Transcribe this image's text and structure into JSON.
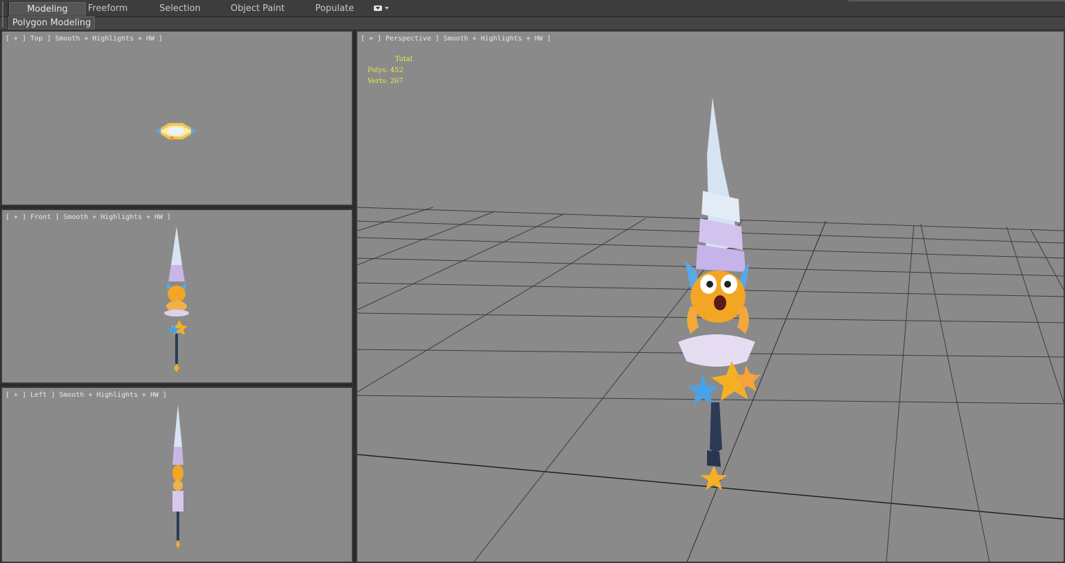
{
  "ribbon": {
    "tabs": [
      {
        "label": "Modeling",
        "active": true
      },
      {
        "label": "Freeform",
        "active": false
      },
      {
        "label": "Selection",
        "active": false
      },
      {
        "label": "Object Paint",
        "active": false
      },
      {
        "label": "Populate",
        "active": false
      }
    ],
    "panel_label": "Polygon Modeling"
  },
  "viewports": {
    "top": {
      "label": "[ + ] Top ] Smooth + Highlights + HW ]"
    },
    "front": {
      "label": "[ + ] Front ] Smooth + Highlights + HW ]"
    },
    "left": {
      "label": "[ + ] Left ] Smooth + Highlights + HW ]"
    },
    "perspective": {
      "label": "[ + ] Perspective ] Smooth + Highlights + HW ]"
    }
  },
  "stats": {
    "total_label": "Total",
    "polys": "Polys: 452",
    "verts": "Verts: 267"
  },
  "colors": {
    "viewport_bg": "#8a8a8a",
    "grid_line": "#3a3a3a",
    "stats_text": "#e8e84a",
    "ui_dark": "#3d3d3d"
  }
}
